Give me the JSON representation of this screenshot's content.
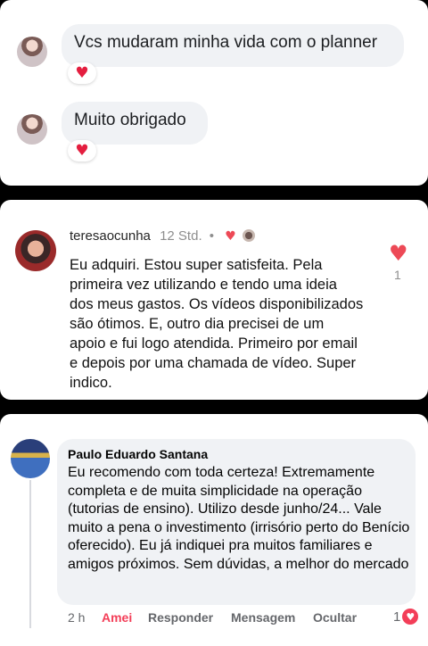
{
  "card1": {
    "comments": [
      {
        "text": "Vcs mudaram minha vida com o planner",
        "reaction_icon": "heart-icon"
      },
      {
        "text": "Muito obrigado",
        "reaction_icon": "heart-icon"
      }
    ]
  },
  "card2": {
    "username": "teresaocunha",
    "time": "12 Std.",
    "separator": "•",
    "text": "Eu adquiri. Estou super satisfeita. Pela primeira vez utilizando e tendo uma ideia dos meus gastos. Os vídeos disponibilizados são ótimos. E, outro dia precisei de um apoio e fui logo atendida. Primeiro por email e depois por uma chamada de vídeo. Super indico.",
    "like_count": "1",
    "heart_color": "#ed4956"
  },
  "card3": {
    "author": "Paulo Eduardo Santana",
    "text": "Eu recomendo com toda certeza! Extremamente completa e de muita simplicidade na operação (tutorias de ensino). Utilizo desde junho/24...  Vale muito a pena o investimento (irrisório perto do Benício oferecido). Eu já indiquei pra muitos familiares e amigos próximos. Sem dúvidas, a melhor do mercado",
    "time": "2 h",
    "actions": {
      "love": "Amei",
      "reply": "Responder",
      "message": "Mensagem",
      "hide": "Ocultar"
    },
    "reaction_count": "1",
    "love_color": "#f33e58"
  }
}
